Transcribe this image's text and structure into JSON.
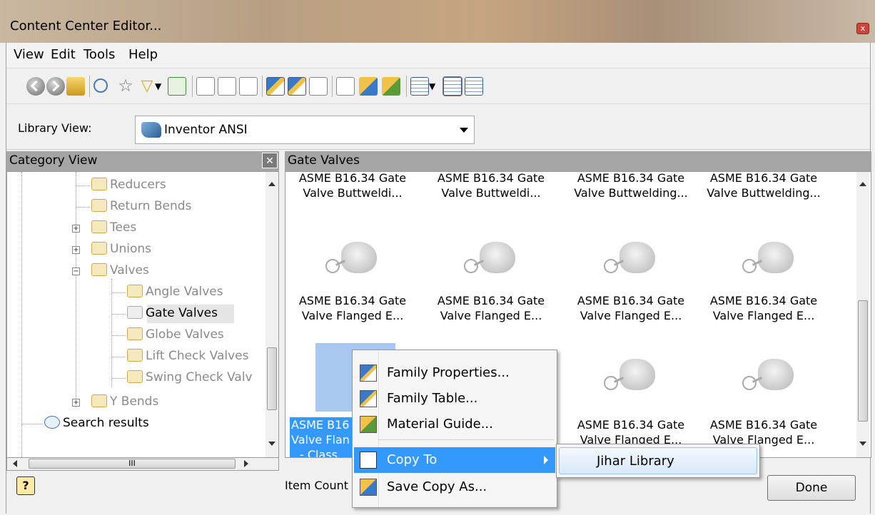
{
  "window": {
    "title": "Content Center Editor...",
    "close_label": "x"
  },
  "menu": [
    "View",
    "Edit",
    "Tools",
    "Help"
  ],
  "library_view": {
    "label": "Library View:",
    "value": "Inventor ANSI"
  },
  "category_view": {
    "header": "Category View",
    "items": [
      {
        "label": "Reducers"
      },
      {
        "label": "Return Bends"
      },
      {
        "label": "Tees"
      },
      {
        "label": "Unions"
      },
      {
        "label": "Valves"
      },
      {
        "label": "Angle Valves"
      },
      {
        "label": "Gate Valves"
      },
      {
        "label": "Globe Valves"
      },
      {
        "label": "Lift Check Valves"
      },
      {
        "label": "Swing Check Valv"
      },
      {
        "label": "Y Bends"
      },
      {
        "label": "Search results"
      }
    ],
    "hscroll_thumb": "III"
  },
  "gate_valves": {
    "header": "Gate Valves",
    "row1": [
      {
        "line1": "ASME B16.34 Gate",
        "line2": "Valve Buttweldi..."
      },
      {
        "line1": "ASME B16.34 Gate",
        "line2": "Valve Buttweldi..."
      },
      {
        "line1": "ASME B16.34 Gate",
        "line2": "Valve Buttwelding..."
      },
      {
        "line1": "ASME B16.34 Gate",
        "line2": "Valve Buttwelding..."
      }
    ],
    "row2": [
      {
        "line1": "ASME B16.34 Gate",
        "line2": "Valve Flanged E..."
      },
      {
        "line1": "ASME B16.34 Gate",
        "line2": "Valve Flanged E..."
      },
      {
        "line1": "ASME B16.34 Gate",
        "line2": "Valve Flanged E..."
      },
      {
        "line1": "ASME B16.34 Gate",
        "line2": "Valve Flanged E..."
      }
    ],
    "row3_selected": {
      "line1": "ASME B16",
      "line2": "Valve Flan",
      "line3": "- Class"
    },
    "row3": [
      {
        "line1": "ASME B16.34 Gate",
        "line2": "Valve Flanged E..."
      },
      {
        "line1": "ASME B16.34 Gate",
        "line2": "Valve Flanged E..."
      }
    ]
  },
  "context_menu": {
    "family_properties": "Family Properties...",
    "family_table": "Family Table...",
    "material_guide": "Material Guide...",
    "copy_to": "Copy To",
    "save_copy_as": "Save Copy As..."
  },
  "submenu": {
    "jihar_library": "Jihar Library"
  },
  "footer": {
    "help": "?",
    "item_count": "Item Count",
    "done": "Done"
  }
}
